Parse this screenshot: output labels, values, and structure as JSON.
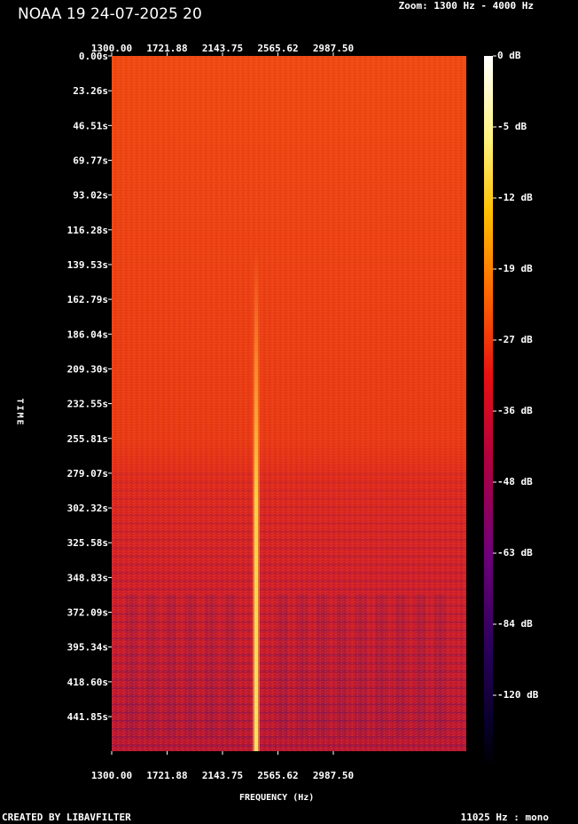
{
  "title": "NOAA 19 24-07-2025 20",
  "zoom_label": "Zoom: 1300 Hz - 4000 Hz",
  "footer_left": "CREATED BY LIBAVFILTER",
  "footer_right": "11025 Hz : mono",
  "chart_data": {
    "type": "heatmap",
    "xlabel": "FREQUENCY (Hz)",
    "ylabel": "TIME",
    "xlim": [
      1300,
      4000
    ],
    "ylim": [
      0,
      465
    ],
    "x_ticks": [
      "1300.00",
      "1721.88",
      "2143.75",
      "2565.62",
      "2987.50"
    ],
    "y_ticks": [
      "0.00s",
      "23.26s",
      "46.51s",
      "69.77s",
      "93.02s",
      "116.28s",
      "139.53s",
      "162.79s",
      "186.04s",
      "209.30s",
      "232.55s",
      "255.81s",
      "279.07s",
      "302.32s",
      "325.58s",
      "348.83s",
      "372.09s",
      "395.34s",
      "418.60s",
      "441.85s"
    ],
    "colorbar_ticks": [
      "0 dB",
      "-5 dB",
      "-12 dB",
      "-19 dB",
      "-27 dB",
      "-36 dB",
      "-48 dB",
      "-63 dB",
      "-84 dB",
      "-120 dB"
    ],
    "carrier_frequency_hz": 2400,
    "carrier_visible_from_s": 130,
    "colors": {
      "background_noise": "#ee4411",
      "faded_noise": "#cc1a2a",
      "faded_band": "#8a1550",
      "carrier": "#ffe060"
    }
  }
}
